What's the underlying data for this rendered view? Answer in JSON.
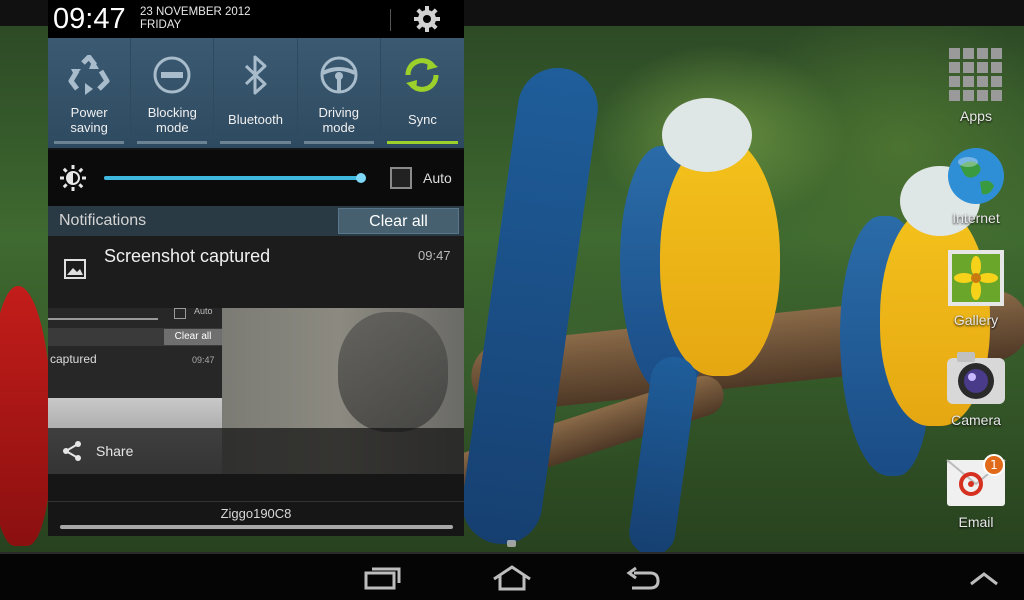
{
  "status": {
    "time": "09:47",
    "date": "23 NOVEMBER 2012",
    "day": "FRIDAY"
  },
  "quick_settings": [
    {
      "label": "Power\nsaving",
      "icon": "recycle-icon",
      "active": false
    },
    {
      "label": "Blocking\nmode",
      "icon": "block-icon",
      "active": false
    },
    {
      "label": "Bluetooth",
      "icon": "bluetooth-icon",
      "active": false
    },
    {
      "label": "Driving\nmode",
      "icon": "steering-wheel-icon",
      "active": false
    },
    {
      "label": "Sync",
      "icon": "sync-icon",
      "active": true
    }
  ],
  "brightness": {
    "level": 0.98,
    "auto_label": "Auto",
    "auto_checked": false
  },
  "notifications": {
    "header": "Notifications",
    "clear_all": "Clear all",
    "items": [
      {
        "title": "Screenshot captured",
        "time": "09:47"
      }
    ],
    "preview": {
      "auto": "Auto",
      "clear_all": "Clear all",
      "captured": "captured",
      "time": "09:47"
    },
    "share_label": "Share"
  },
  "carrier": "Ziggo190C8",
  "home_shortcuts": [
    {
      "label": "Apps",
      "icon": "apps-grid-icon"
    },
    {
      "label": "Internet",
      "icon": "globe-icon"
    },
    {
      "label": "Gallery",
      "icon": "gallery-icon"
    },
    {
      "label": "Camera",
      "icon": "camera-icon"
    },
    {
      "label": "Email",
      "icon": "email-icon",
      "badge": "1"
    }
  ],
  "colors": {
    "accent": "#3fb8e0",
    "sync_active": "#9bd12a",
    "toggle_bg": "#3b5a72"
  }
}
